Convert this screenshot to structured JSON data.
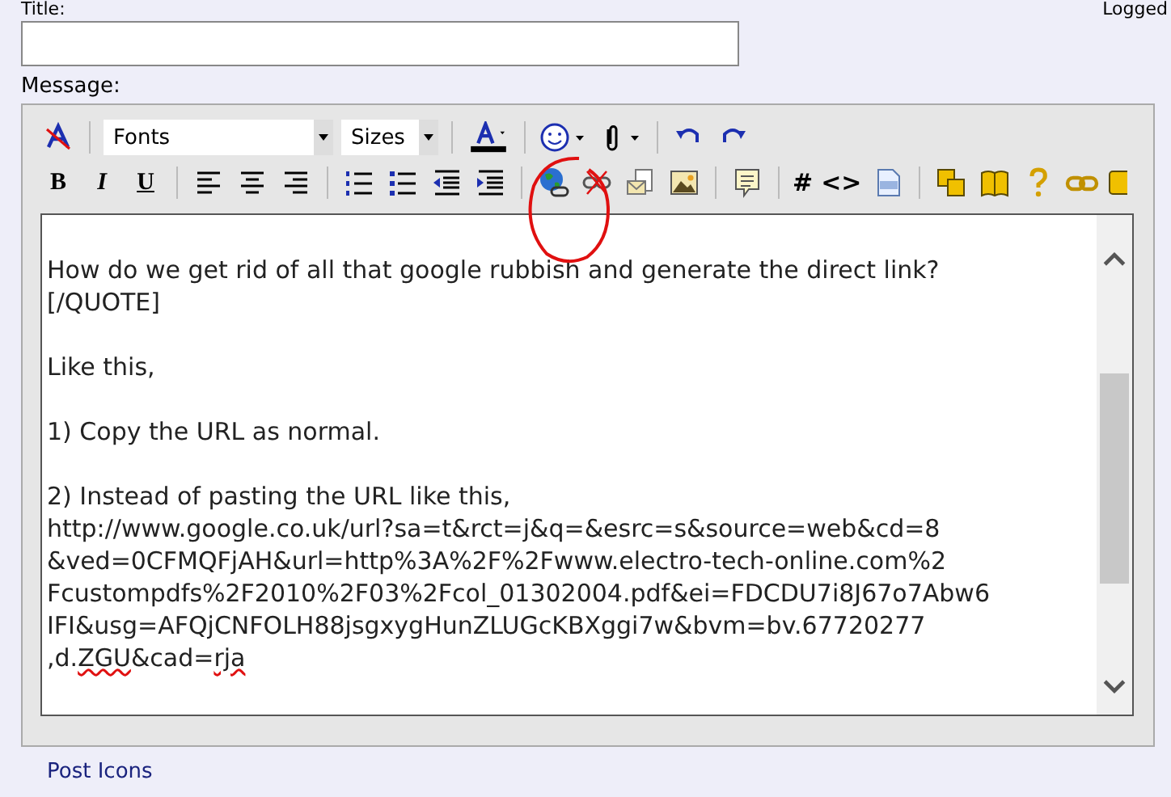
{
  "title_field": {
    "label": "Title:"
  },
  "logged_label": "Logged",
  "message_label": "Message:",
  "toolbar": {
    "font_select": "Fonts",
    "size_select": "Sizes",
    "text_buttons": [
      "B",
      "I",
      "U"
    ],
    "code_buttons": [
      "#",
      "<>"
    ]
  },
  "editor_paragraphs": [
    [
      [
        {
          "text": "How do we get rid of all that google rubbish and generate the direct link?",
          "misspelled": false
        }
      ],
      [
        {
          "text": "[/QUOTE]",
          "misspelled": false
        }
      ]
    ],
    [
      [
        {
          "text": "Like this,",
          "misspelled": false
        }
      ]
    ],
    [
      [
        {
          "text": "1) Copy the URL as normal.",
          "misspelled": false
        }
      ]
    ],
    [
      [
        {
          "text": "2) Instead of pasting the URL like this,",
          "misspelled": false
        }
      ],
      [
        {
          "text": "http://www.google.co.uk/url?sa=t&rct=j&q=&esrc=s&source=web&cd=8",
          "misspelled": false
        }
      ],
      [
        {
          "text": "&ved=0CFMQFjAH&url=http%3A%2F%2Fwww.electro-tech-online.com%2",
          "misspelled": false
        }
      ],
      [
        {
          "text": "Fcustompdfs%2F2010%2F03%2Fcol_01302004.pdf&ei=FDCDU7i8J67o7Abw6",
          "misspelled": false
        }
      ],
      [
        {
          "text": "IFI&usg=AFQjCNFOLH88jsgxygHunZLUGcKBXggi7w&bvm=bv.67720277",
          "misspelled": false
        }
      ],
      [
        {
          "text": ",d.",
          "misspelled": false
        },
        {
          "text": "ZGU",
          "misspelled": true
        },
        {
          "text": "&cad=",
          "misspelled": false
        },
        {
          "text": "rja",
          "misspelled": true
        }
      ]
    ]
  ],
  "post_icons_link": "Post Icons"
}
